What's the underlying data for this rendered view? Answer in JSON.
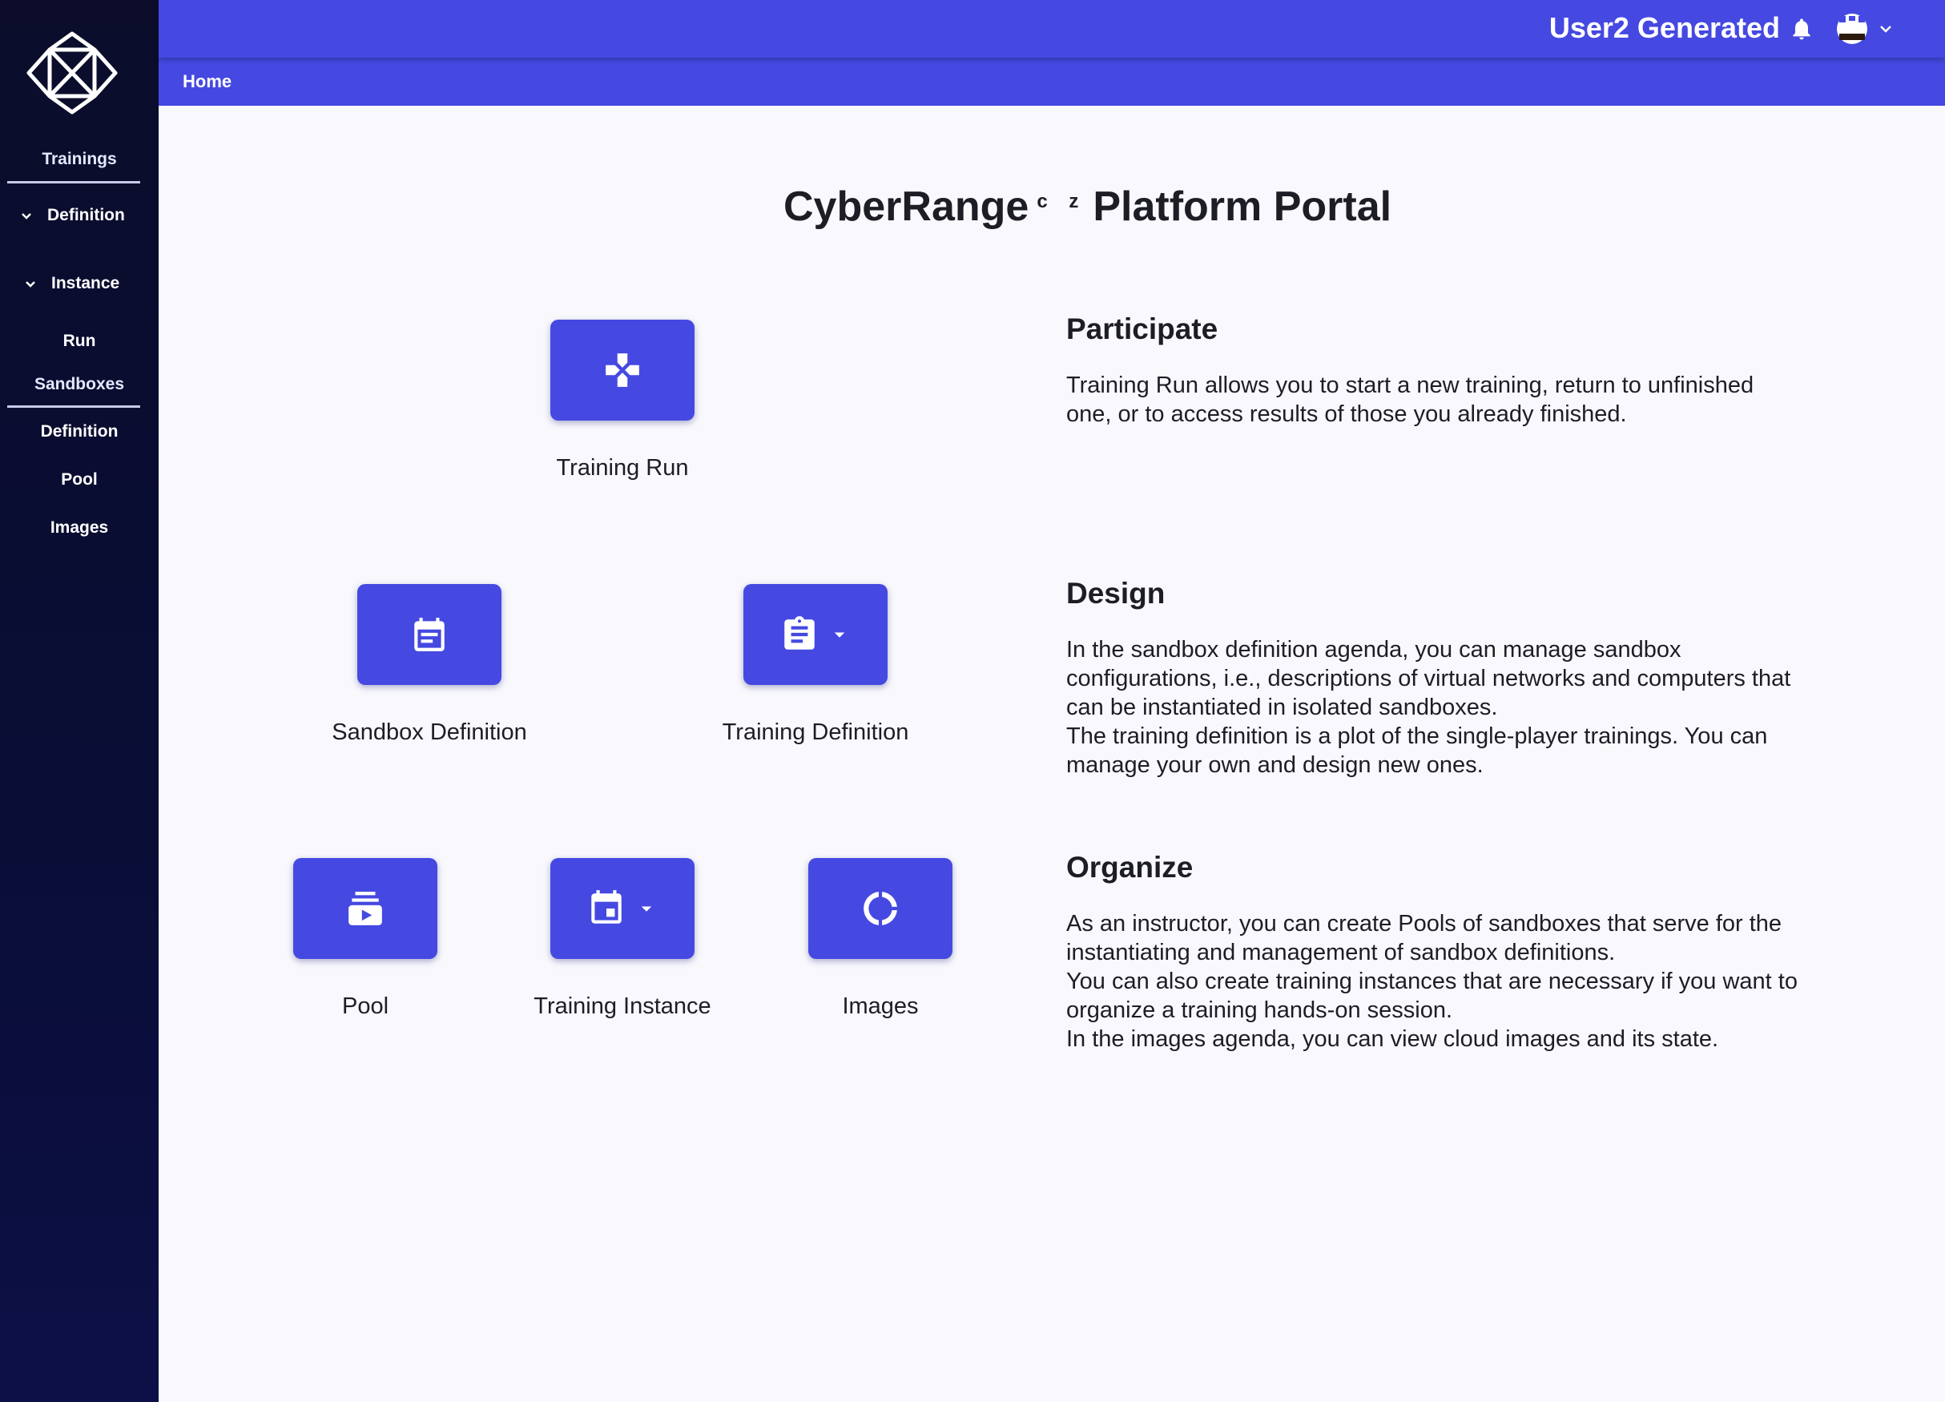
{
  "sidebar": {
    "logo": "cyberrange-logo",
    "trainings_heading": "Trainings",
    "definition_label": "Definition",
    "instance_label": "Instance",
    "run_label": "Run",
    "sandboxes_heading": "Sandboxes",
    "sandbox_items": [
      "Definition",
      "Pool",
      "Images"
    ]
  },
  "header": {
    "user_name": "User2 Generated",
    "bell_icon": "bell-icon",
    "avatar_icon": "avatar-icon"
  },
  "breadcrumb": "Home",
  "main": {
    "title": "CyberRange",
    "title_sup": "c z",
    "title_suffix": "Platform Portal",
    "tiles": {
      "training_run": "Training Run",
      "sandbox_definition": "Sandbox Definition",
      "training_definition": "Training Definition",
      "pool": "Pool",
      "training_instance": "Training Instance",
      "images": "Images"
    },
    "sections": {
      "participate": {
        "heading": "Participate",
        "lines": [
          "Training Run allows you to start a new training, return to unfinished",
          "one, or to access results of those you already finished."
        ]
      },
      "design": {
        "heading": "Design",
        "lines": [
          "In the sandbox definition agenda, you can manage sandbox",
          "configurations, i.e., descriptions of virtual networks and computers that",
          "can be instantiated in isolated sandboxes.",
          "The training definition is a plot of the single-player trainings. You can",
          "manage your own and design new ones."
        ]
      },
      "organize": {
        "heading": "Organize",
        "lines": [
          "As an instructor, you can create Pools of sandboxes that serve for the",
          "instantiating and management of sandbox definitions.",
          "You can also create training instances that are necessary if you want to",
          "organize a training hands-on session.",
          "In the images agenda, you can view cloud images and its state."
        ]
      }
    }
  },
  "colors": {
    "accent": "#4549e1",
    "sidebar": "#0b0d2b",
    "background": "#f8f8fd"
  }
}
